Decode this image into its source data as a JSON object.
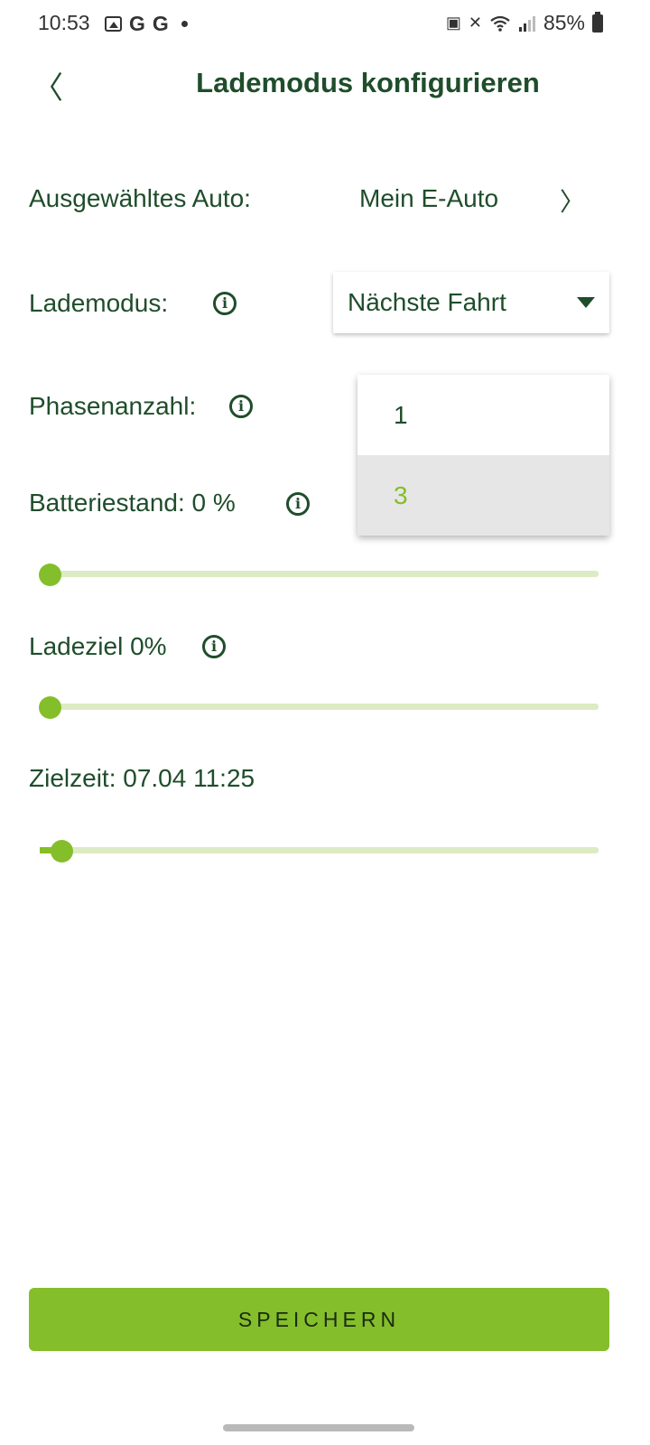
{
  "status_bar": {
    "time": "10:53",
    "left_icons": [
      "image-icon",
      "google-icon",
      "google-icon",
      "dot-icon"
    ],
    "g1": "G",
    "g2": "G",
    "battery": "85%",
    "right_icons": [
      "battery-saver-icon",
      "mute-icon",
      "wifi-icon",
      "signal-icon",
      "battery-icon"
    ]
  },
  "header": {
    "back_icon": "〈",
    "title": "Lademodus konfigurieren"
  },
  "car": {
    "label": "Ausgewähltes Auto:",
    "value": "Mein E-Auto",
    "chevron": "〉"
  },
  "mode": {
    "label": "Lademodus:",
    "selected": "Nächste Fahrt"
  },
  "phases": {
    "label": "Phasenanzahl:",
    "options": [
      "1",
      "3"
    ],
    "highlighted": "3"
  },
  "battery_level": {
    "label": "Batteriestand: 0 %",
    "value_percent": 0
  },
  "charge_target": {
    "label": "Ladeziel 0%",
    "value_percent": 0
  },
  "target_time": {
    "label": "Zielzeit: 07.04 11:25",
    "value_fraction": 0.02
  },
  "save": {
    "label": "SPEICHERN"
  },
  "colors": {
    "primary_dark": "#1f4d2b",
    "accent": "#84be2a",
    "track": "#dcebc3"
  },
  "info_glyph": "i"
}
